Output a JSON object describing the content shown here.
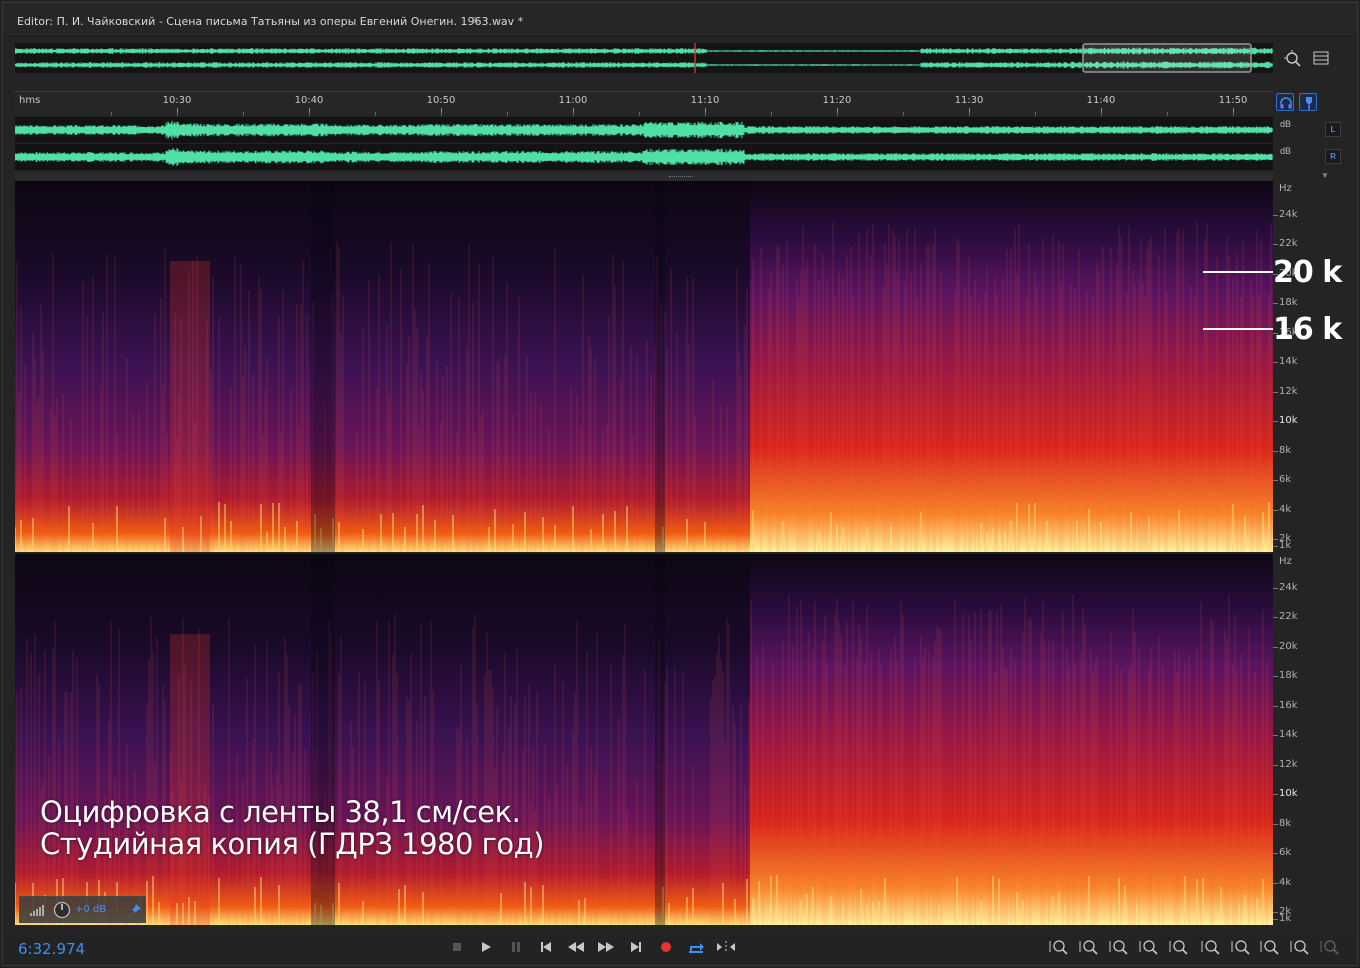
{
  "title": "Editor: П. И. Чайковский - Сцена письма Татьяны из оперы Евгений Онегин. 1963.wav *",
  "title_menu_icon": "≡",
  "colors": {
    "waveform": "#4fe0a6",
    "accent": "#3d8ff0",
    "record": "#e8322c",
    "playhead": "#c0392b"
  },
  "ruler": {
    "unit": "hms",
    "labels": [
      "10:30",
      "10:40",
      "10:50",
      "11:00",
      "11:10",
      "11:20",
      "11:30",
      "11:40",
      "11:50"
    ]
  },
  "channels": [
    {
      "db": "dB",
      "badge": "L"
    },
    {
      "db": "dB",
      "badge": "R"
    }
  ],
  "spectral_axis": {
    "unit": "Hz",
    "labels": [
      "24k",
      "22k",
      "20k",
      "18k",
      "16k",
      "14k",
      "12k",
      "10k",
      "8k",
      "6k",
      "4k",
      "2k",
      "1k"
    ],
    "bold_label": "10k"
  },
  "callouts": [
    "20 k",
    "16 k"
  ],
  "caption_lines": [
    "Оцифровка с ленты 38,1 см/сек.",
    "Студийная копия (ГДРЗ 1980 год)"
  ],
  "hud": {
    "level": "+0 dB"
  },
  "transport": {
    "time": "6:32.974",
    "buttons": [
      "stop",
      "play",
      "pause",
      "move-to-previous",
      "rewind",
      "fast-forward",
      "move-to-next",
      "record",
      "loop-playback",
      "skip-selection"
    ]
  },
  "zoom_buttons": [
    "zoom-in-amplitude",
    "zoom-out-amplitude",
    "zoom-in-time",
    "zoom-out-time",
    "zoom-out-full",
    "zoom-in-selection",
    "zoom-to-selection-left",
    "zoom-to-selection-right",
    "zoom-reset",
    "zoom-disabled"
  ]
}
